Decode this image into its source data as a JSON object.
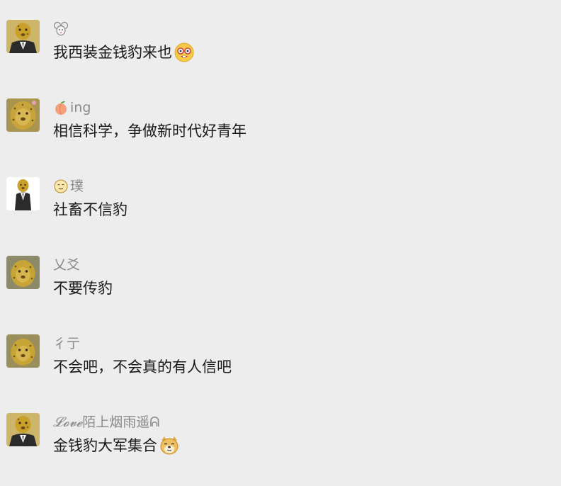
{
  "messages": [
    {
      "avatar_icon": "leopard-suit-avatar-icon",
      "nick_emoji_icon": "mouse-face-icon",
      "nickname": "",
      "text": "我西装金钱豹来也",
      "tail_emoji_icon": "nerd-face-icon"
    },
    {
      "avatar_icon": "leopard-avatar-icon",
      "nick_emoji_icon": "peach-icon",
      "nickname": "ing",
      "text": "相信科学，争做新时代好青年"
    },
    {
      "avatar_icon": "leopard-suit-white-avatar-icon",
      "nick_emoji_icon": "smiling-face-icon",
      "nickname": "璞",
      "text": "社畜不信豹"
    },
    {
      "avatar_icon": "leopard-avatar-icon",
      "nickname": "乂爻",
      "text": "不要传豹"
    },
    {
      "avatar_icon": "leopard-avatar-icon",
      "nickname": "彳亍",
      "text": "不会吧，不会真的有人信吧"
    },
    {
      "avatar_icon": "leopard-suit-avatar-icon",
      "nickname_script": "𝓛𝓸𝓿𝓮",
      "nickname": "陌上烟雨遥ᕱ",
      "text": "金钱豹大军集合",
      "tail_emoji_icon": "doge-icon"
    }
  ]
}
